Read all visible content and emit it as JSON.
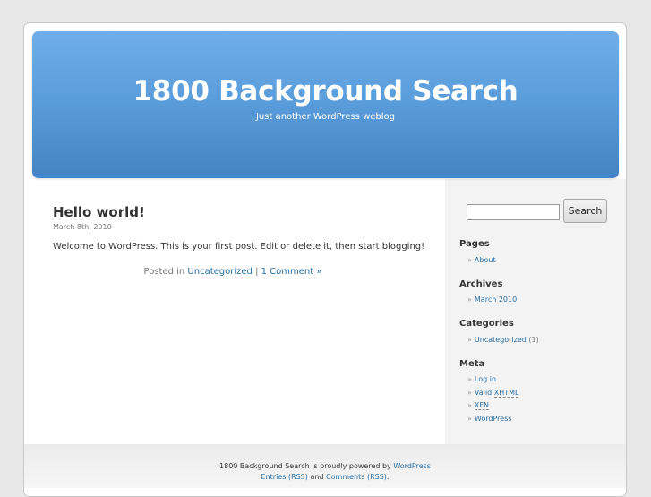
{
  "blog": {
    "title": "1800 Background Search",
    "description": "Just another WordPress weblog"
  },
  "post": {
    "title": "Hello world!",
    "date": "March 8th, 2010",
    "content": "Welcome to WordPress. This is your first post. Edit or delete it, then start blogging!",
    "posted_in": "Posted in",
    "category": "Uncategorized",
    "separator": " | ",
    "comments": "1 Comment »"
  },
  "sidebar": {
    "search_button": "Search",
    "search_value": "",
    "widgets": {
      "pages": {
        "title": "Pages",
        "items": [
          "About"
        ]
      },
      "archives": {
        "title": "Archives",
        "items": [
          "March 2010"
        ]
      },
      "categories": {
        "title": "Categories",
        "item": "Uncategorized",
        "count": "(1)"
      },
      "meta": {
        "title": "Meta",
        "login": "Log in",
        "valid_prefix": "Valid",
        "valid_abbr": "XHTML",
        "xfn": "XFN",
        "wordpress": "WordPress"
      }
    },
    "bullet": "»"
  },
  "footer": {
    "prefix": "1800 Background Search is proudly powered by",
    "wordpress": "WordPress",
    "entries_rss": "Entries (RSS)",
    "and": "and",
    "comments_rss": "Comments (RSS)",
    "end": "."
  },
  "colors": {
    "header_top": "#6faee8",
    "header_bottom": "#4583c4",
    "link": "#2970a6"
  }
}
